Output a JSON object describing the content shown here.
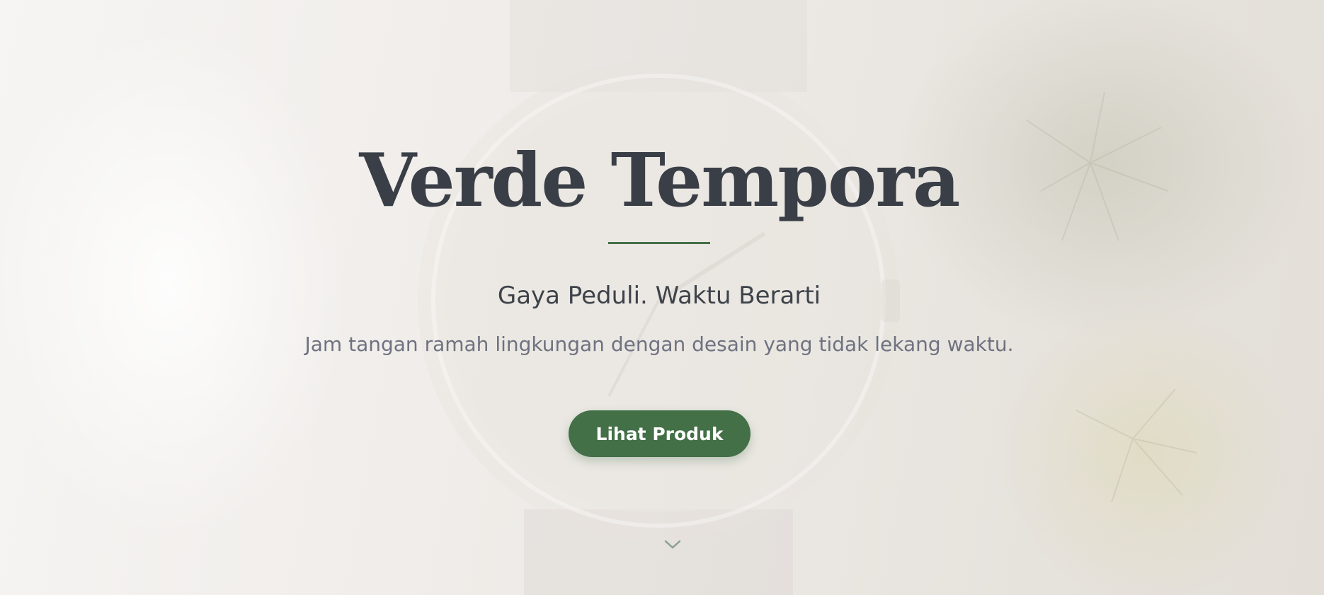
{
  "hero": {
    "title": "Verde Tempora",
    "tagline": "Gaya Peduli. Waktu Berarti",
    "description": "Jam tangan ramah lingkungan dengan desain yang tidak lekang waktu.",
    "cta_label": "Lihat Produk",
    "scroll_icon": "chevron-down-icon"
  },
  "colors": {
    "accent": "#437047",
    "title": "#3a3f47",
    "tagline": "#3e434a",
    "description": "#6e7280",
    "button_text": "#ffffff",
    "chevron": "#8ba08c",
    "background": "#efece8"
  }
}
